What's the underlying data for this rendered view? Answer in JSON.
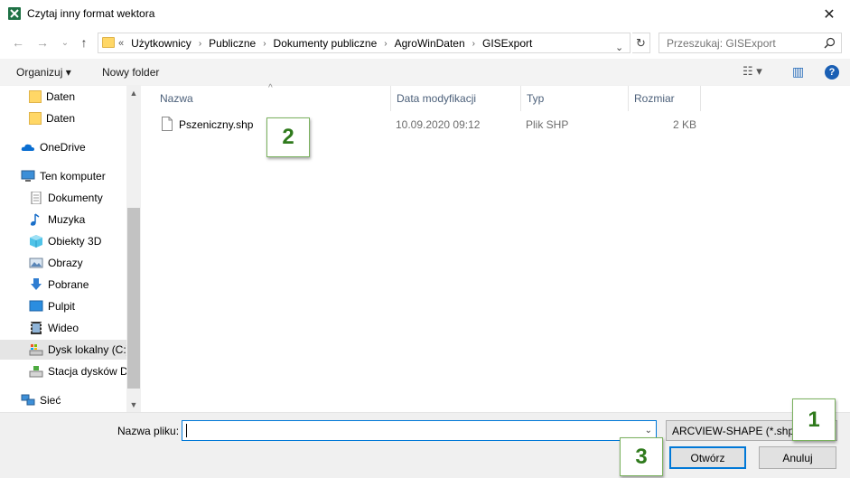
{
  "window": {
    "title": "Czytaj inny format wektora",
    "close_glyph": "✕"
  },
  "nav": {
    "back": "←",
    "forward": "→",
    "recent": "⌄",
    "up": "↑"
  },
  "address": {
    "lead": "«",
    "crumbs": [
      "Użytkownicy",
      "Publiczne",
      "Dokumenty publiczne",
      "AgroWinDaten",
      "GISExport"
    ],
    "sep": "›",
    "dropdown": "⌄",
    "refresh": "↻"
  },
  "search": {
    "placeholder": "Przeszukaj: GISExport"
  },
  "toolbar": {
    "organize": "Organizuj ▾",
    "new_folder": "Nowy folder",
    "view_glyph": "☷ ▾",
    "pane_glyph": "▥",
    "help": "?"
  },
  "sidebar": {
    "items": [
      {
        "label": "Daten",
        "icon": "folder-icon"
      },
      {
        "label": "Daten",
        "icon": "folder-icon"
      },
      {
        "label": "OneDrive",
        "icon": "cloud-icon"
      },
      {
        "label": "Ten komputer",
        "icon": "computer-icon"
      },
      {
        "label": "Dokumenty",
        "icon": "documents-icon"
      },
      {
        "label": "Muzyka",
        "icon": "music-icon"
      },
      {
        "label": "Obiekty 3D",
        "icon": "cube-icon"
      },
      {
        "label": "Obrazy",
        "icon": "pictures-icon"
      },
      {
        "label": "Pobrane",
        "icon": "download-icon"
      },
      {
        "label": "Pulpit",
        "icon": "desktop-icon"
      },
      {
        "label": "Wideo",
        "icon": "video-icon"
      },
      {
        "label": "Dysk lokalny (C:)",
        "icon": "drive-icon"
      },
      {
        "label": "Stacja dysków D",
        "icon": "dvd-drive-icon"
      },
      {
        "label": "Sieć",
        "icon": "network-icon"
      }
    ],
    "scroll_up": "▲",
    "scroll_down": "▼"
  },
  "columns": {
    "name": "Nazwa",
    "modified": "Data modyfikacji",
    "type": "Typ",
    "size": "Rozmiar",
    "sort_glyph": "^"
  },
  "files": [
    {
      "name": "Pszeniczny.shp",
      "modified": "10.09.2020 09:12",
      "type": "Plik SHP",
      "size": "2 KB"
    }
  ],
  "footer": {
    "filename_label": "Nazwa pliku:",
    "filename_value": "",
    "filename_dropdown": "⌄",
    "filter": "ARCVIEW-SHAPE (*.shp)",
    "open": "Otwórz",
    "cancel": "Anuluj"
  },
  "badges": {
    "b1": "1",
    "b2": "2",
    "b3": "3"
  },
  "colors": {
    "accent": "#0078d7",
    "badge_green": "#2f7a1c",
    "folder": "#ffd766"
  }
}
